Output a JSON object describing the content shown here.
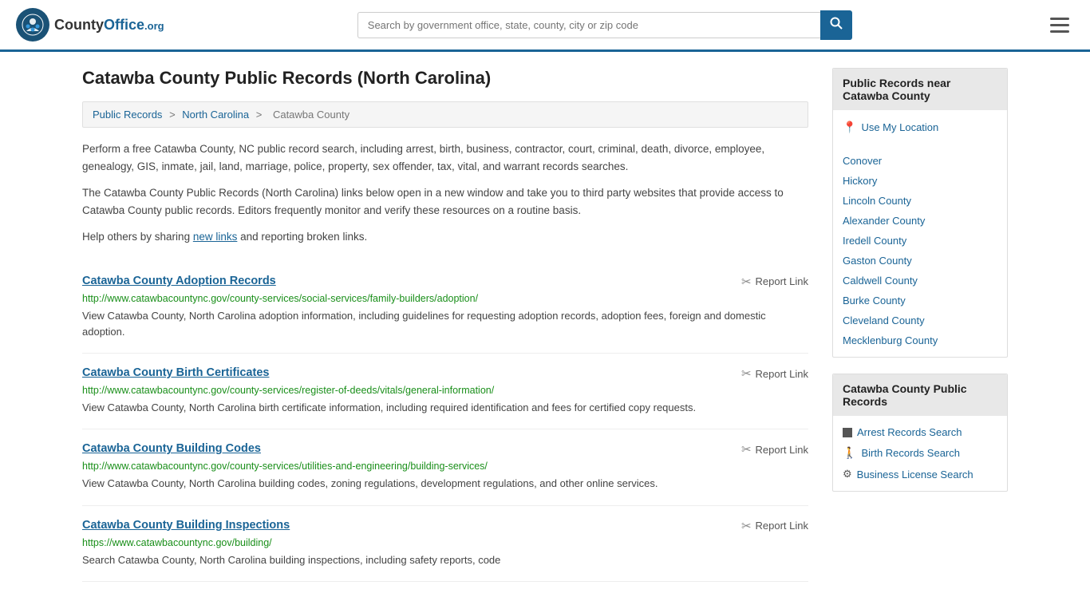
{
  "header": {
    "logo_text": "County",
    "logo_org": ".org",
    "search_placeholder": "Search by government office, state, county, city or zip code",
    "search_button_label": "🔍"
  },
  "page": {
    "title": "Catawba County Public Records (North Carolina)",
    "breadcrumb": {
      "items": [
        "Public Records",
        "North Carolina",
        "Catawba County"
      ]
    },
    "description1": "Perform a free Catawba County, NC public record search, including arrest, birth, business, contractor, court, criminal, death, divorce, employee, genealogy, GIS, inmate, jail, land, marriage, police, property, sex offender, tax, vital, and warrant records searches.",
    "description2": "The Catawba County Public Records (North Carolina) links below open in a new window and take you to third party websites that provide access to Catawba County public records. Editors frequently monitor and verify these resources on a routine basis.",
    "description3_prefix": "Help others by sharing ",
    "description3_link": "new links",
    "description3_suffix": " and reporting broken links."
  },
  "records": [
    {
      "title": "Catawba County Adoption Records",
      "url": "http://www.catawbacountync.gov/county-services/social-services/family-builders/adoption/",
      "description": "View Catawba County, North Carolina adoption information, including guidelines for requesting adoption records, adoption fees, foreign and domestic adoption.",
      "report_label": "Report Link"
    },
    {
      "title": "Catawba County Birth Certificates",
      "url": "http://www.catawbacountync.gov/county-services/register-of-deeds/vitals/general-information/",
      "description": "View Catawba County, North Carolina birth certificate information, including required identification and fees for certified copy requests.",
      "report_label": "Report Link"
    },
    {
      "title": "Catawba County Building Codes",
      "url": "http://www.catawbacountync.gov/county-services/utilities-and-engineering/building-services/",
      "description": "View Catawba County, North Carolina building codes, zoning regulations, development regulations, and other online services.",
      "report_label": "Report Link"
    },
    {
      "title": "Catawba County Building Inspections",
      "url": "https://www.catawbacountync.gov/building/",
      "description": "Search Catawba County, North Carolina building inspections, including safety reports, code",
      "report_label": "Report Link"
    }
  ],
  "sidebar": {
    "nearby_title": "Public Records near Catawba County",
    "use_my_location": "Use My Location",
    "nearby_links": [
      "Conover",
      "Hickory",
      "Lincoln County",
      "Alexander County",
      "Iredell County",
      "Gaston County",
      "Caldwell County",
      "Burke County",
      "Cleveland County",
      "Mecklenburg County"
    ],
    "records_title": "Catawba County Public Records",
    "records_links": [
      {
        "label": "Arrest Records Search",
        "icon": "square"
      },
      {
        "label": "Birth Records Search",
        "icon": "person"
      },
      {
        "label": "Business License Search",
        "icon": "gear"
      }
    ]
  }
}
